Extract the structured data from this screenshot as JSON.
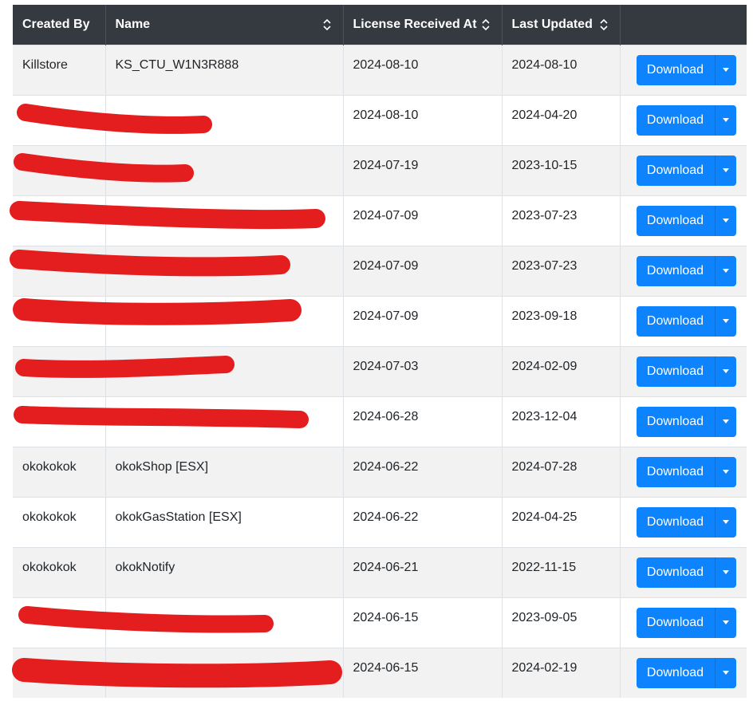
{
  "table": {
    "columns": [
      {
        "label": "Created By",
        "sortable": false
      },
      {
        "label": "Name",
        "sortable": true
      },
      {
        "label": "License Received At",
        "sortable": true
      },
      {
        "label": "Last Updated",
        "sortable": true
      },
      {
        "label": "",
        "sortable": false
      }
    ],
    "download_label": "Download",
    "rows": [
      {
        "created_by": "Killstore",
        "name": "KS_CTU_W1N3R888",
        "received": "2024-08-10",
        "updated": "2024-08-10"
      },
      {
        "created_by": "",
        "name": "",
        "received": "2024-08-10",
        "updated": "2024-04-20"
      },
      {
        "created_by": "",
        "name": "",
        "received": "2024-07-19",
        "updated": "2023-10-15"
      },
      {
        "created_by": "",
        "name": "",
        "received": "2024-07-09",
        "updated": "2023-07-23"
      },
      {
        "created_by": "",
        "name": "",
        "received": "2024-07-09",
        "updated": "2023-07-23"
      },
      {
        "created_by": "",
        "name": "",
        "received": "2024-07-09",
        "updated": "2023-09-18"
      },
      {
        "created_by": "",
        "name": "",
        "received": "2024-07-03",
        "updated": "2024-02-09"
      },
      {
        "created_by": "",
        "name": "",
        "received": "2024-06-28",
        "updated": "2023-12-04"
      },
      {
        "created_by": "okokokok",
        "name": "okokShop [ESX]",
        "received": "2024-06-22",
        "updated": "2024-07-28"
      },
      {
        "created_by": "okokokok",
        "name": "okokGasStation [ESX]",
        "received": "2024-06-22",
        "updated": "2024-04-25"
      },
      {
        "created_by": "okokokok",
        "name": "okokNotify",
        "received": "2024-06-21",
        "updated": "2022-11-15"
      },
      {
        "created_by": "",
        "name": "",
        "received": "2024-06-15",
        "updated": "2023-09-05"
      },
      {
        "created_by": "",
        "name": "",
        "received": "2024-06-15",
        "updated": "2024-02-19"
      }
    ]
  },
  "colors": {
    "header_bg": "#343a40",
    "button": "#0d83fd",
    "redaction": "#e41e1e"
  }
}
